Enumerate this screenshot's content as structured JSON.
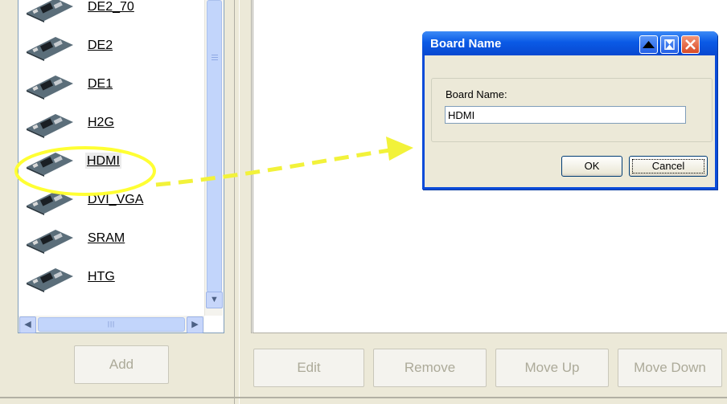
{
  "boards": [
    {
      "label": "DE2_70"
    },
    {
      "label": "DE2"
    },
    {
      "label": "DE1"
    },
    {
      "label": "H2G"
    },
    {
      "label": "HDMI",
      "selected": true
    },
    {
      "label": "DVI_VGA"
    },
    {
      "label": "SRAM"
    },
    {
      "label": "HTG"
    }
  ],
  "buttons": {
    "add": "Add",
    "edit": "Edit",
    "remove": "Remove",
    "move_up": "Move Up",
    "move_down": "Move Down"
  },
  "dialog": {
    "title": "Board Name",
    "field_label": "Board Name:",
    "field_value": "HDMI",
    "ok": "OK",
    "cancel": "Cancel"
  },
  "colors": {
    "title_bar": "#0a5ae6",
    "close_button": "#e0512f",
    "highlight_ring": "#ffff33",
    "arrow": "#f2f23a"
  }
}
